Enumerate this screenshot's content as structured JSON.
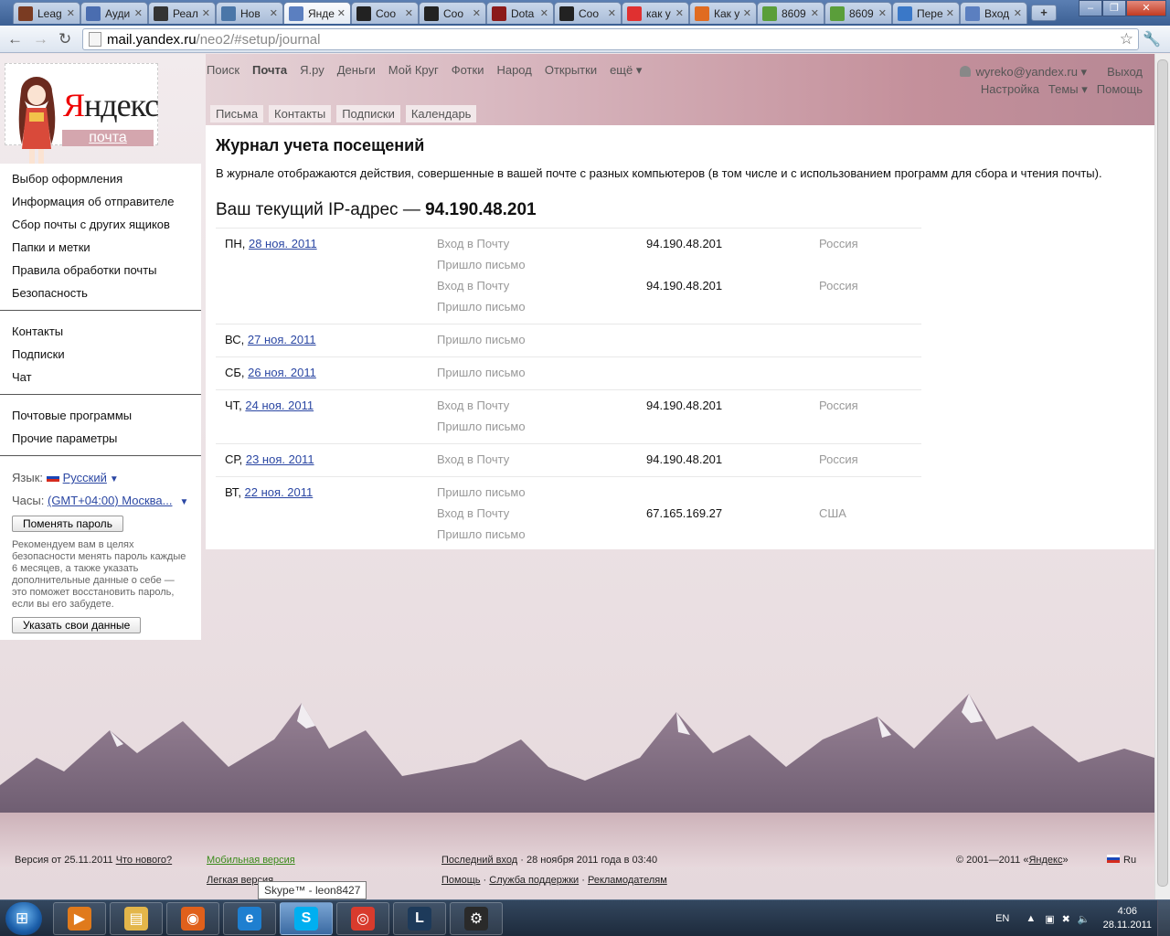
{
  "browser": {
    "tabs": [
      {
        "label": "Leag",
        "color": "#7a3b22"
      },
      {
        "label": "Ауди",
        "color": "#4a6db0"
      },
      {
        "label": "Реал",
        "color": "#333333"
      },
      {
        "label": "Нов",
        "color": "#4a76a8"
      },
      {
        "label": "Янде",
        "color": "#5b7fc0"
      },
      {
        "label": "Coo",
        "color": "#222222"
      },
      {
        "label": "Coo",
        "color": "#222222"
      },
      {
        "label": "Dota",
        "color": "#8b1a1a"
      },
      {
        "label": "Coo",
        "color": "#222222"
      },
      {
        "label": "как у",
        "color": "#e03030"
      },
      {
        "label": "Как у",
        "color": "#e06b20"
      },
      {
        "label": "8609",
        "color": "#5a9e3a"
      },
      {
        "label": "8609",
        "color": "#5a9e3a"
      },
      {
        "label": "Пере",
        "color": "#3a78c8"
      },
      {
        "label": "Вход",
        "color": "#5b7fc0"
      }
    ],
    "active_tab_index": 4,
    "url_host": "mail.yandex.ru",
    "url_path": "/neo2/#setup/journal"
  },
  "logo": {
    "word_first": "Я",
    "word_rest": "ндекс",
    "sub": "почта"
  },
  "topnav": [
    "Поиск",
    "Почта",
    "Я.ру",
    "Деньги",
    "Мой Круг",
    "Фотки",
    "Народ",
    "Открытки",
    "ещё ▾"
  ],
  "topnav_current": 1,
  "user": {
    "email": "wyreko@yandex.ru ▾",
    "logout": "Выход",
    "settings": "Настройка",
    "themes": "Темы ▾",
    "help": "Помощь"
  },
  "subtabs": [
    "Письма",
    "Контакты",
    "Подписки",
    "Календарь"
  ],
  "sidebar": {
    "group1": [
      "Выбор оформления",
      "Информация об отправителе",
      "Сбор почты с других ящиков",
      "Папки и метки",
      "Правила обработки почты",
      "Безопасность"
    ],
    "group2": [
      "Контакты",
      "Подписки",
      "Чат"
    ],
    "group3": [
      "Почтовые программы",
      "Прочие параметры"
    ],
    "language_label": "Язык:",
    "language_value": "Русский",
    "clock_label": "Часы:",
    "clock_value": "(GMT+04:00) Москва...",
    "change_password": "Поменять пароль",
    "advice": "Рекомендуем вам в целях безопасности менять пароль каждые 6 месяцев, а также указать дополнительные данные о себе — это поможет восстановить пароль, если вы его забудете.",
    "specify_data": "Указать свои данные"
  },
  "main": {
    "title": "Журнал учета посещений",
    "description": "В журнале отображаются действия, совершенные в вашей почте с разных компьютеров (в том числе и с использованием программ для сбора и чтения почты).",
    "ip_prefix": "Ваш текущий IP-адрес — ",
    "ip_value": "94.190.48.201"
  },
  "journal": [
    {
      "dow": "ПН",
      "date": "28 ноя. 2011",
      "events": [
        {
          "event": "Вход в Почту",
          "ip": "94.190.48.201",
          "country": "Россия"
        },
        {
          "event": "Пришло письмо",
          "ip": "",
          "country": ""
        },
        {
          "event": "Вход в Почту",
          "ip": "94.190.48.201",
          "country": "Россия"
        },
        {
          "event": "Пришло письмо",
          "ip": "",
          "country": ""
        }
      ]
    },
    {
      "dow": "ВС",
      "date": "27 ноя. 2011",
      "events": [
        {
          "event": "Пришло письмо",
          "ip": "",
          "country": ""
        }
      ]
    },
    {
      "dow": "СБ",
      "date": "26 ноя. 2011",
      "events": [
        {
          "event": "Пришло письмо",
          "ip": "",
          "country": ""
        }
      ]
    },
    {
      "dow": "ЧТ",
      "date": "24 ноя. 2011",
      "events": [
        {
          "event": "Вход в Почту",
          "ip": "94.190.48.201",
          "country": "Россия"
        },
        {
          "event": "Пришло письмо",
          "ip": "",
          "country": ""
        }
      ]
    },
    {
      "dow": "СР",
      "date": "23 ноя. 2011",
      "events": [
        {
          "event": "Вход в Почту",
          "ip": "94.190.48.201",
          "country": "Россия"
        }
      ]
    },
    {
      "dow": "ВТ",
      "date": "22 ноя. 2011",
      "events": [
        {
          "event": "Пришло письмо",
          "ip": "",
          "country": ""
        },
        {
          "event": "Вход в Почту",
          "ip": "67.165.169.27",
          "country": "США"
        },
        {
          "event": "Пришло письмо",
          "ip": "",
          "country": ""
        }
      ]
    }
  ],
  "footer": {
    "version": "Версия от 25.11.2011",
    "whats_new": "Что нового?",
    "mobile": "Мобильная версия",
    "light": "Легкая версия",
    "last_login_link": "Последний вход",
    "last_login_text": " · 28 ноября 2011 года в 03:40",
    "help": "Помощь",
    "support": "Служба поддержки",
    "advertisers": "Рекламодателям",
    "copyright_prefix": "© 2001—2011 «",
    "copyright_link": "Яндекс",
    "copyright_suffix": "»",
    "lang": "Ru"
  },
  "tooltip": "Skype™ - leon8427",
  "taskbar": {
    "apps": [
      {
        "name": "media-player",
        "color": "#e07a1c",
        "glyph": "▶"
      },
      {
        "name": "explorer",
        "color": "#e3b64a",
        "glyph": "▤"
      },
      {
        "name": "firefox",
        "color": "#e0601b",
        "glyph": "◉"
      },
      {
        "name": "internet-explorer",
        "color": "#1e7fd0",
        "glyph": "e"
      },
      {
        "name": "skype",
        "color": "#00aff0",
        "glyph": "S"
      },
      {
        "name": "chrome",
        "color": "#d83b2d",
        "glyph": "◎"
      },
      {
        "name": "league-of-legends",
        "color": "#1d3a5a",
        "glyph": "L"
      },
      {
        "name": "steam",
        "color": "#2a2a2a",
        "glyph": "⚙"
      }
    ],
    "lang": "EN",
    "time": "4:06",
    "date": "28.11.2011"
  }
}
